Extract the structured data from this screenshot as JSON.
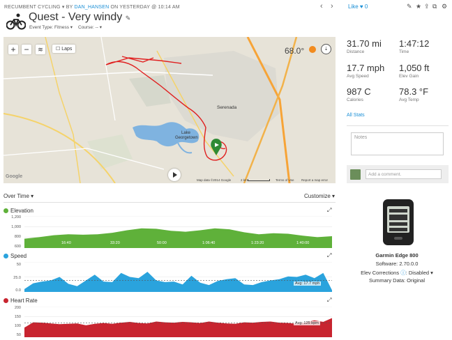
{
  "header": {
    "breadcrumb_type": "RECUMBENT CYCLING",
    "breadcrumb_by": "BY",
    "breadcrumb_user": "DAN_HANSEN",
    "breadcrumb_when": "ON YESTERDAY @ 10:14 AM",
    "title": "Quest - Very windy",
    "edit_icon": "pencil-icon",
    "event_type": "Event Type: Fitness",
    "course": "Course: --",
    "like_label": "Like",
    "like_count": "0"
  },
  "map": {
    "laps_label": "Laps",
    "temperature": "68.0°",
    "place_serenada": "Serenada",
    "place_lake": "Lake",
    "place_lake2": "Georgetown",
    "data_label": "Map data ©2014 Google",
    "scale_label": "2 km",
    "terms_label": "Terms of Use",
    "report_label": "Report a map error",
    "google_label": "Google"
  },
  "stats": [
    {
      "value": "31.70 mi",
      "label": "Distance"
    },
    {
      "value": "1:47:12",
      "label": "Time"
    },
    {
      "value": "17.7 mph",
      "label": "Avg Speed"
    },
    {
      "value": "1,050 ft",
      "label": "Elev Gain"
    },
    {
      "value": "987 C",
      "label": "Calories"
    },
    {
      "value": "78.3 °F",
      "label": "Avg Temp"
    }
  ],
  "all_stats": "All Stats",
  "notes_placeholder": "Notes",
  "comment_placeholder": "Add a comment.",
  "device": {
    "name": "Garmin Edge 800",
    "software": "Software: 2.70.0.0",
    "elev_corrections": "Elev Corrections",
    "elev_status": ": Disabled",
    "summary": "Summary Data: Original"
  },
  "charts_header": {
    "over_time": "Over Time",
    "customize": "Customize"
  },
  "colors": {
    "elevation": "#5fb13a",
    "speed": "#2aa3dd",
    "heart_rate": "#c8242f",
    "link": "#1a8fd6"
  },
  "chart_data": [
    {
      "type": "area",
      "title": "Elevation",
      "yticks": [
        "1,200",
        "1,000",
        "800",
        "600"
      ],
      "ylim": [
        600,
        1250
      ],
      "xticks": [
        "16:40",
        "33:20",
        "50:00",
        "1:06:40",
        "1:23:20",
        "1:40:00"
      ],
      "x": [
        0,
        5,
        10,
        15,
        20,
        25,
        30,
        35,
        40,
        45,
        50,
        55,
        60,
        65,
        70,
        75,
        80,
        85,
        90,
        95,
        100,
        105
      ],
      "values": [
        790,
        820,
        860,
        880,
        870,
        880,
        910,
        960,
        1000,
        990,
        950,
        930,
        960,
        1000,
        980,
        920,
        880,
        900,
        890,
        850,
        820,
        840
      ]
    },
    {
      "type": "area",
      "title": "Speed",
      "yticks": [
        "50",
        "25.0",
        "0.0"
      ],
      "ylim": [
        0,
        52
      ],
      "avg_label": "Avg: 17.7 mph",
      "x": [
        0,
        3,
        6,
        9,
        12,
        15,
        18,
        21,
        24,
        27,
        30,
        33,
        36,
        39,
        42,
        45,
        48,
        51,
        54,
        57,
        60,
        63,
        66,
        69,
        72,
        75,
        78,
        81,
        84,
        87,
        90,
        93,
        96,
        99,
        102,
        105
      ],
      "values": [
        5,
        15,
        18,
        20,
        26,
        14,
        10,
        20,
        30,
        18,
        17,
        33,
        26,
        24,
        35,
        20,
        17,
        18,
        13,
        28,
        16,
        12,
        19,
        22,
        24,
        13,
        12,
        17,
        20,
        22,
        27,
        26,
        30,
        24,
        33,
        3
      ]
    },
    {
      "type": "area",
      "title": "Heart Rate",
      "yticks": [
        "200",
        "150",
        "100",
        "50"
      ],
      "ylim": [
        50,
        210
      ],
      "avg_label": "Avg: 125 bpm",
      "x": [
        0,
        3,
        6,
        9,
        12,
        15,
        18,
        21,
        24,
        27,
        30,
        33,
        36,
        39,
        42,
        45,
        48,
        51,
        54,
        57,
        60,
        63,
        66,
        69,
        72,
        75,
        78,
        81,
        84,
        87,
        90,
        93,
        96,
        99,
        102,
        105
      ],
      "values": [
        100,
        128,
        126,
        122,
        118,
        120,
        122,
        112,
        120,
        124,
        120,
        126,
        130,
        124,
        122,
        132,
        128,
        126,
        130,
        128,
        124,
        132,
        126,
        122,
        120,
        128,
        126,
        130,
        132,
        126,
        124,
        120,
        128,
        138,
        130,
        150
      ]
    }
  ]
}
